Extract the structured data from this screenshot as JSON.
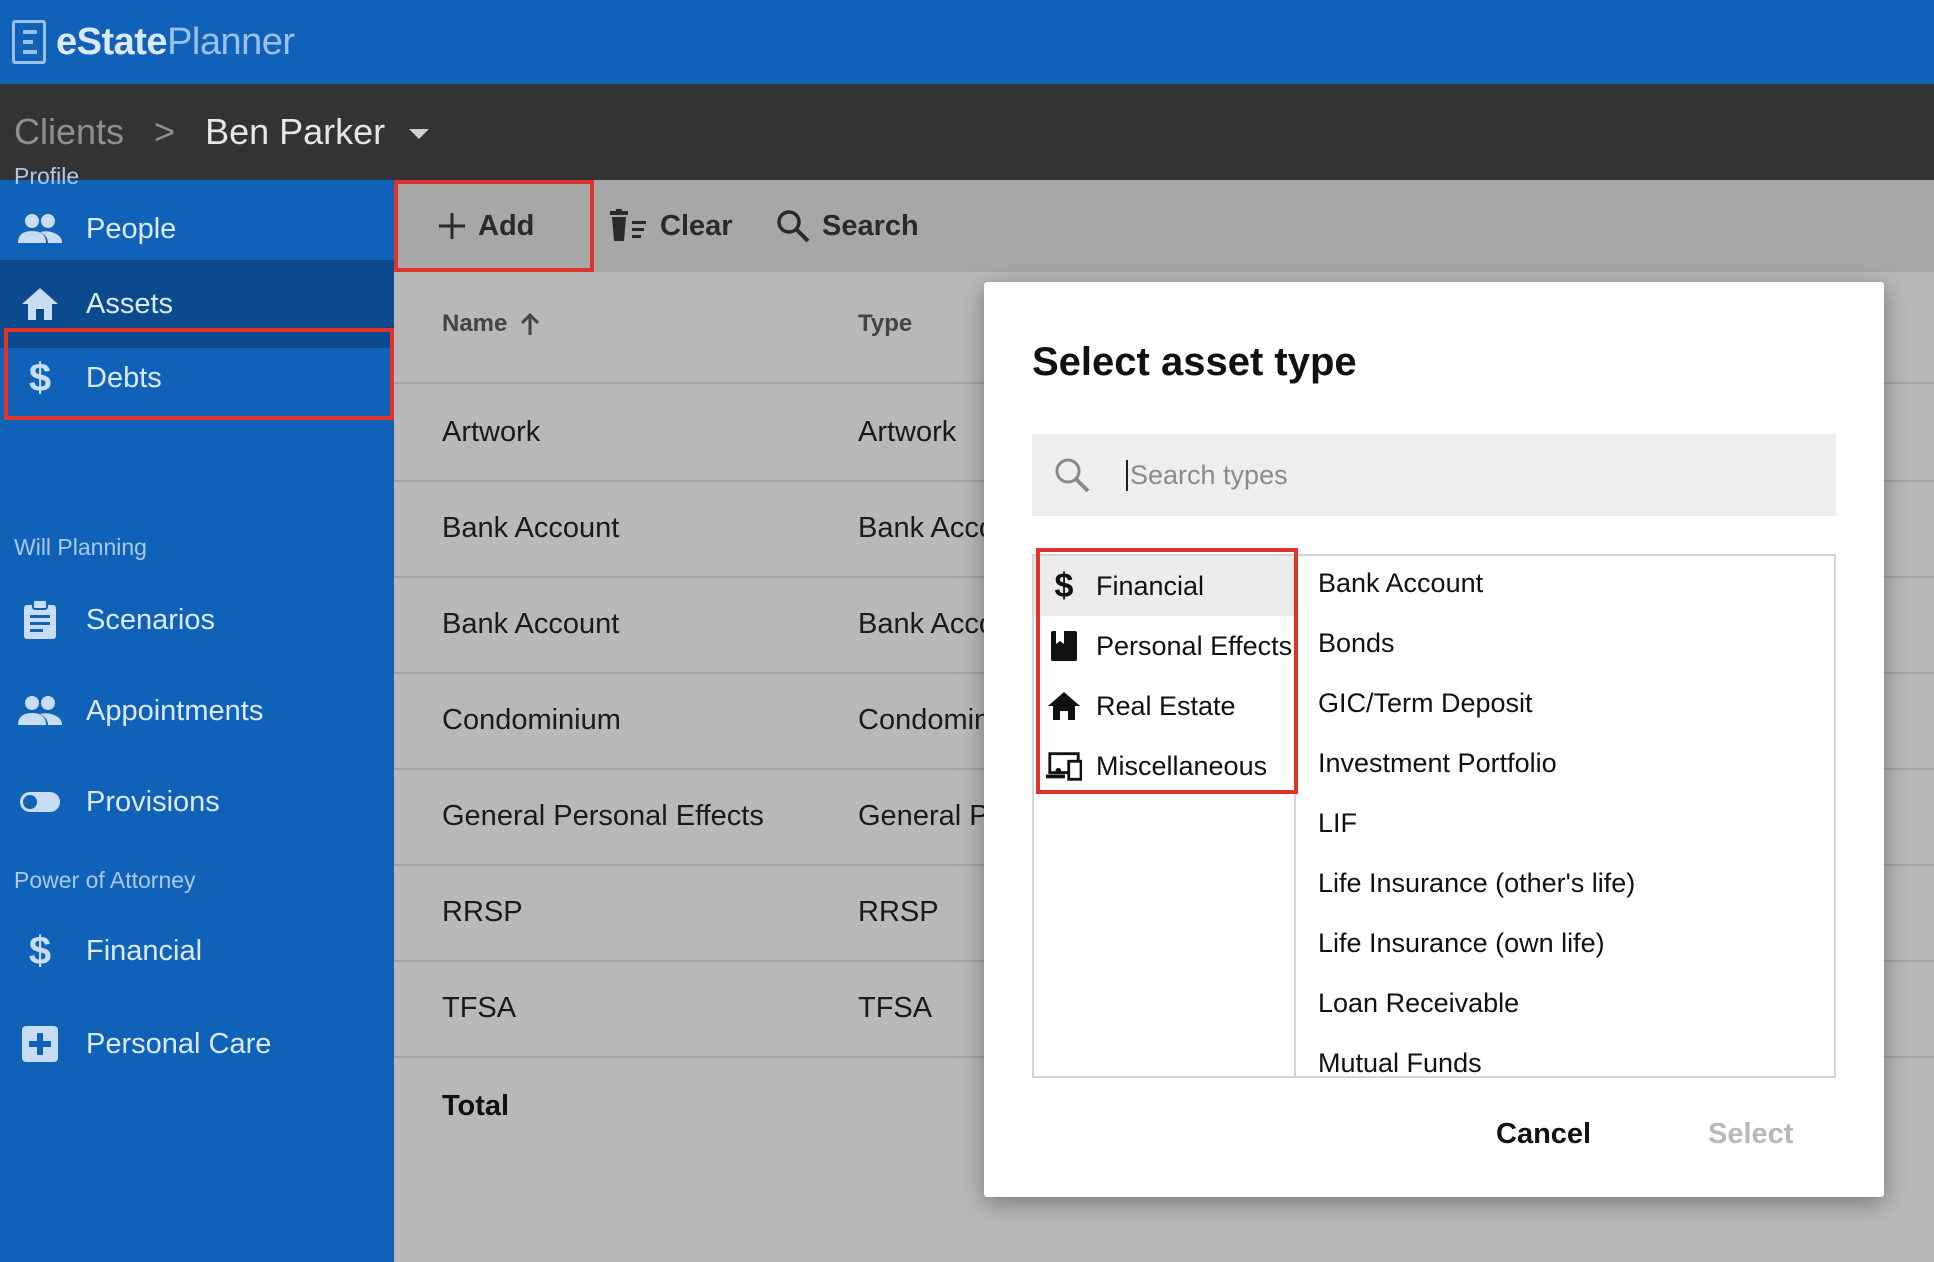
{
  "app": {
    "logo_bold": "eState",
    "logo_light": "Planner"
  },
  "breadcrumb": {
    "root": "Clients",
    "separator": ">",
    "client": "Ben Parker"
  },
  "sidebar": {
    "sections": [
      "Profile",
      "Will Planning",
      "Power of Attorney"
    ],
    "items": [
      {
        "label": "People",
        "icon": "people-icon"
      },
      {
        "label": "Assets",
        "icon": "home-icon",
        "active": true
      },
      {
        "label": "Debts",
        "icon": "dollar-icon"
      },
      {
        "label": "Scenarios",
        "icon": "clipboard-icon"
      },
      {
        "label": "Appointments",
        "icon": "people-icon"
      },
      {
        "label": "Provisions",
        "icon": "toggle-icon"
      },
      {
        "label": "Financial",
        "icon": "dollar-icon"
      },
      {
        "label": "Personal Care",
        "icon": "medical-plus-icon"
      }
    ]
  },
  "toolbar": {
    "add_label": "Add",
    "clear_label": "Clear",
    "search_label": "Search"
  },
  "table": {
    "columns": [
      "Name",
      "Type"
    ],
    "rows": [
      {
        "name": "Artwork",
        "type": "Artwork"
      },
      {
        "name": "Bank Account",
        "type": "Bank Acco"
      },
      {
        "name": "Bank Account",
        "type": "Bank Acco"
      },
      {
        "name": "Condominium",
        "type": "Condomin"
      },
      {
        "name": "General Personal Effects",
        "type": "General Pe"
      },
      {
        "name": "RRSP",
        "type": "RRSP"
      },
      {
        "name": "TFSA",
        "type": "TFSA"
      }
    ],
    "total_label": "Total"
  },
  "dialog": {
    "title": "Select asset type",
    "search_placeholder": "Search types",
    "categories": [
      {
        "label": "Financial",
        "icon": "dollar-icon",
        "selected": true
      },
      {
        "label": "Personal Effects",
        "icon": "book-icon"
      },
      {
        "label": "Real Estate",
        "icon": "home-icon"
      },
      {
        "label": "Miscellaneous",
        "icon": "devices-icon"
      }
    ],
    "types": [
      "Bank Account",
      "Bonds",
      "GIC/Term Deposit",
      "Investment Portfolio",
      "LIF",
      "Life Insurance (other's life)",
      "Life Insurance (own life)",
      "Loan Receivable",
      "Mutual Funds"
    ],
    "cancel_label": "Cancel",
    "select_label": "Select"
  },
  "colors": {
    "brand": "#1062b8",
    "active_nav": "#0c4a8e",
    "highlight": "#e0332b"
  }
}
